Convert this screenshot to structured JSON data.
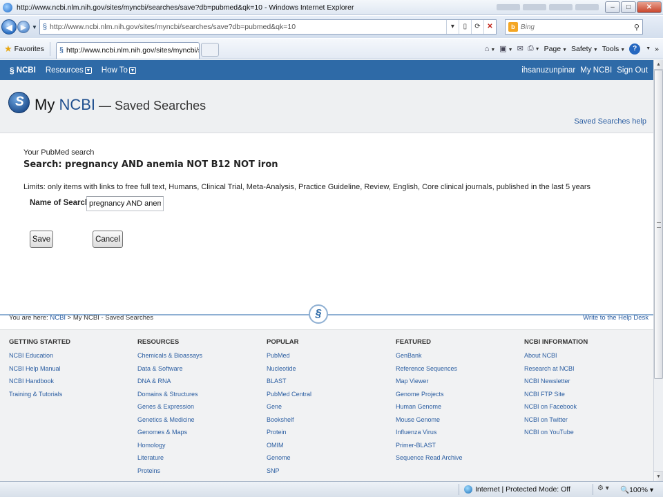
{
  "window": {
    "title": "http://www.ncbi.nlm.nih.gov/sites/myncbi/searches/save?db=pubmed&qk=10 - Windows Internet Explorer",
    "minimize": "–",
    "maximize": "□",
    "close": "✕"
  },
  "address": {
    "url": "http://www.ncbi.nlm.nih.gov/sites/myncbi/searches/save?db=pubmed&qk=10",
    "search_placeholder": "Bing"
  },
  "tabs": {
    "favorites_label": "Favorites",
    "active_tab": "http://www.ncbi.nlm.nih.gov/sites/myncbi/searc..."
  },
  "command_bar": {
    "page": "Page",
    "safety": "Safety",
    "tools": "Tools",
    "more": "»"
  },
  "ncbi_bar": {
    "logo": "NCBI",
    "resources": "Resources",
    "how_to": "How To",
    "user": "ihsanuzunpinar",
    "my_ncbi": "My NCBI",
    "sign_out": "Sign Out"
  },
  "header": {
    "my": "My ",
    "ncbi": "NCBI",
    "subtitle": " — Saved Searches",
    "help_link": "Saved Searches help"
  },
  "form": {
    "intro": "Your PubMed search",
    "search": "Search: pregnancy AND anemia NOT B12 NOT iron",
    "limits": "Limits: only items with links to free full text, Humans, Clinical Trial, Meta-Analysis, Practice Guideline, Review, English, Core clinical journals, published in the last 5 years",
    "name_label": "Name of Search:",
    "name_value": "pregnancy AND anemia N",
    "save_label": "Save",
    "cancel_label": "Cancel"
  },
  "breadcrumb": {
    "prefix": "You are here: ",
    "ncbi": "NCBI",
    "sep": " > ",
    "current": "My NCBI - Saved Searches",
    "help_desk": "Write to the Help Desk"
  },
  "footer": {
    "columns": [
      {
        "heading": "GETTING STARTED",
        "links": [
          "NCBI Education",
          "NCBI Help Manual",
          "NCBI Handbook",
          "Training & Tutorials"
        ]
      },
      {
        "heading": "RESOURCES",
        "links": [
          "Chemicals & Bioassays",
          "Data & Software",
          "DNA & RNA",
          "Domains & Structures",
          "Genes & Expression",
          "Genetics & Medicine",
          "Genomes & Maps",
          "Homology",
          "Literature",
          "Proteins"
        ]
      },
      {
        "heading": "POPULAR",
        "links": [
          "PubMed",
          "Nucleotide",
          "BLAST",
          "PubMed Central",
          "Gene",
          "Bookshelf",
          "Protein",
          "OMIM",
          "Genome",
          "SNP"
        ]
      },
      {
        "heading": "FEATURED",
        "links": [
          "GenBank",
          "Reference Sequences",
          "Map Viewer",
          "Genome Projects",
          "Human Genome",
          "Mouse Genome",
          "Influenza Virus",
          "Primer-BLAST",
          "Sequence Read Archive"
        ]
      },
      {
        "heading": "NCBI INFORMATION",
        "links": [
          "About NCBI",
          "Research at NCBI",
          "NCBI Newsletter",
          "NCBI FTP Site",
          "NCBI on Facebook",
          "NCBI on Twitter",
          "NCBI on YouTube"
        ]
      }
    ]
  },
  "status": {
    "zone": "Internet | Protected Mode: Off",
    "zoom": "100%"
  },
  "colors": {
    "ncbi_blue": "#2e6aa7",
    "link_blue": "#2a5da1",
    "divider_blue": "#8fb0d3"
  }
}
